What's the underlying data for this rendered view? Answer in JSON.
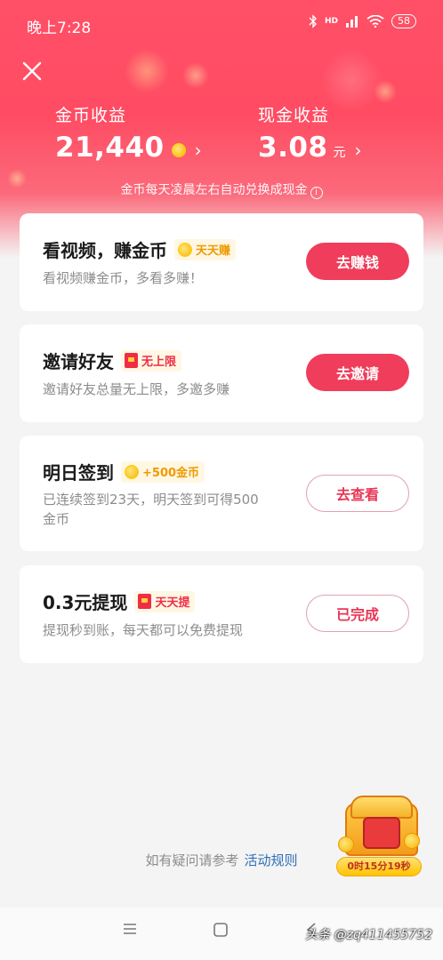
{
  "status_bar": {
    "time": "晚上7:28",
    "network": "HD",
    "battery": "58"
  },
  "header": {
    "coin_earnings": {
      "label": "金币收益",
      "value": "21,440"
    },
    "cash_earnings": {
      "label": "现金收益",
      "value": "3.08",
      "unit": "元"
    },
    "note": "金币每天凌晨左右自动兑换成现金"
  },
  "tasks": [
    {
      "title": "看视频，赚金币",
      "badge": "天天赚",
      "badge_icon": "coin-icon",
      "desc": "看视频赚金币，多看多赚！",
      "button": "去赚钱"
    },
    {
      "title": "邀请好友",
      "badge": "无上限",
      "badge_icon": "red-packet-icon",
      "desc": "邀请好友总量无上限，多邀多赚",
      "button": "去邀请"
    },
    {
      "title": "明日签到",
      "badge": "+500金币",
      "badge_icon": "coin-icon",
      "desc_line1": "已连续签到23天，明天签到可得500",
      "desc_line2": "金币",
      "button": "去查看"
    },
    {
      "title": "0.3元提现",
      "badge": "天天提",
      "badge_icon": "red-packet-icon",
      "desc": "提现秒到账，每天都可以免费提现",
      "button": "已完成"
    }
  ],
  "footer": {
    "prefix": "如有疑问请参考",
    "link": "活动规则"
  },
  "treasure_chest": {
    "timer": "0时15分19秒"
  },
  "watermark": "头条 @zq411455752",
  "colors": {
    "brand_red": "#ef3d5b",
    "header_red": "#ff5067",
    "link_blue": "#2f6fb8"
  }
}
